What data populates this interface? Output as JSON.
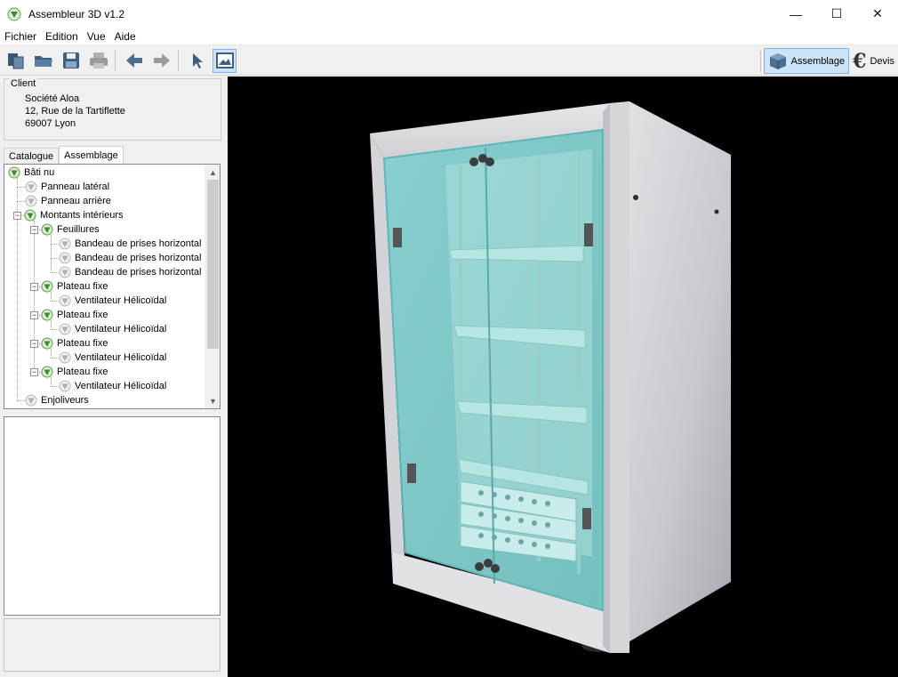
{
  "window": {
    "title": "Assembleur 3D v1.2",
    "controls": {
      "minimize": "—",
      "maximize": "☐",
      "close": "✕"
    }
  },
  "menu": [
    "Fichier",
    "Edition",
    "Vue",
    "Aide"
  ],
  "toolbar": {
    "buttons": [
      "copy-icon",
      "open-folder-icon",
      "save-icon",
      "print-icon",
      "back-arrow-icon",
      "forward-arrow-icon",
      "pointer-icon",
      "view-image-icon"
    ],
    "modes": {
      "assemblage": "Assemblage",
      "devis": "Devis",
      "devis_symbol": "€"
    }
  },
  "client": {
    "legend": "Client",
    "name": "Société Aloa",
    "street": "12, Rue de la Tartiflette",
    "city": "69007 Lyon"
  },
  "tabs": {
    "catalogue": "Catalogue",
    "assemblage": "Assemblage"
  },
  "tree": [
    {
      "label": "Bâti nu",
      "level": 0
    },
    {
      "label": "Panneau latéral",
      "level": 1
    },
    {
      "label": "Panneau arrière",
      "level": 1
    },
    {
      "label": "Montants intérieurs",
      "level": 1
    },
    {
      "label": "Feuillures",
      "level": 2
    },
    {
      "label": "Bandeau de prises horizontal",
      "level": 3
    },
    {
      "label": "Bandeau de prises horizontal",
      "level": 3
    },
    {
      "label": "Bandeau de prises horizontal",
      "level": 3
    },
    {
      "label": "Plateau fixe",
      "level": 2
    },
    {
      "label": "Ventilateur Hélicoïdal",
      "level": 3
    },
    {
      "label": "Plateau fixe",
      "level": 2
    },
    {
      "label": "Ventilateur Hélicoïdal",
      "level": 3
    },
    {
      "label": "Plateau fixe",
      "level": 2
    },
    {
      "label": "Ventilateur Hélicoïdal",
      "level": 3
    },
    {
      "label": "Plateau fixe",
      "level": 2
    },
    {
      "label": "Ventilateur Hélicoïdal",
      "level": 3
    },
    {
      "label": "Enjoliveurs",
      "level": 1
    }
  ],
  "colors": {
    "cabinet_frame": "#c8c8cc",
    "glass": "#7fd3d3",
    "viewport_bg": "#000000",
    "selected_tool": "#cce4f7"
  }
}
